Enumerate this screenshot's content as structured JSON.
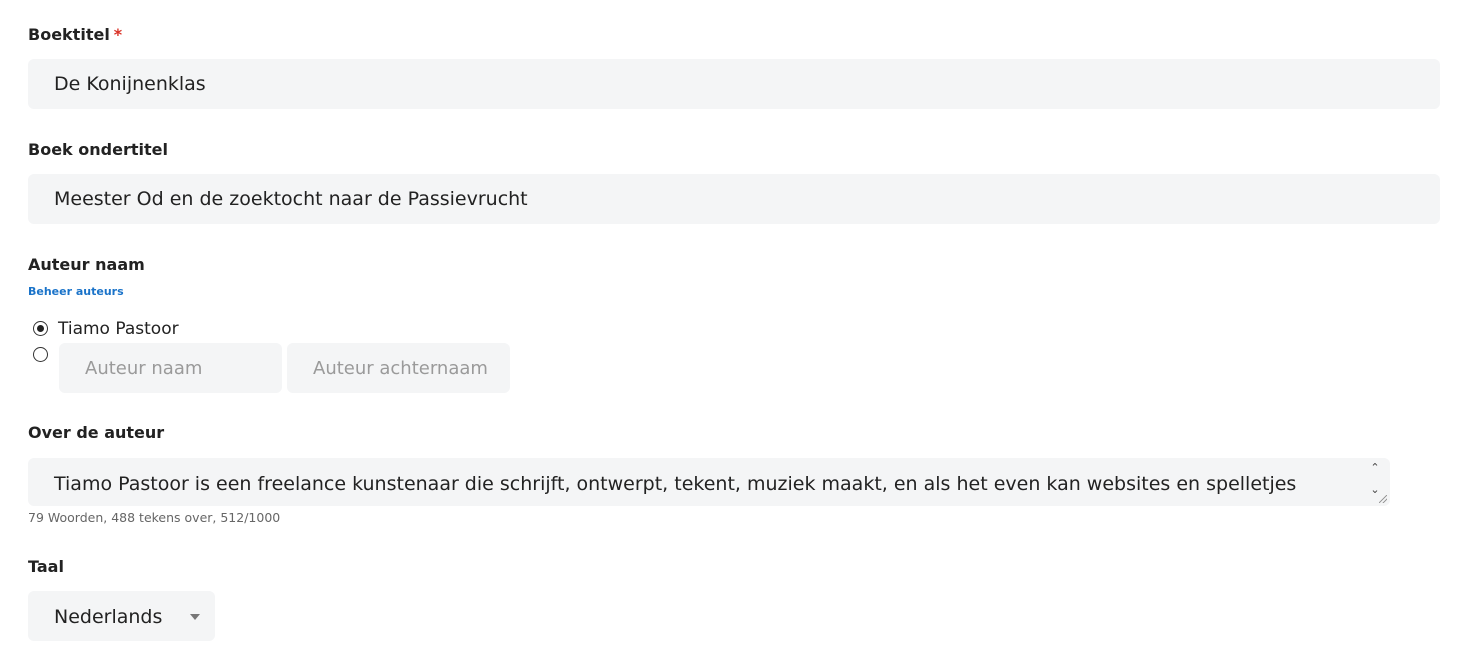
{
  "book_title": {
    "label": "Boektitel",
    "required_marker": "*",
    "value": "De Konijnenklas"
  },
  "book_subtitle": {
    "label": "Boek ondertitel",
    "value": "Meester Od en de zoektocht naar de Passievrucht"
  },
  "author": {
    "label": "Auteur naam",
    "manage_link": "Beheer auteurs",
    "options": [
      {
        "label": "Tiamo Pastoor",
        "selected": true
      },
      {
        "label": "",
        "selected": false
      }
    ],
    "first_name_placeholder": "Auteur naam",
    "last_name_placeholder": "Auteur achternaam"
  },
  "about_author": {
    "label": "Over de auteur",
    "value": "Tiamo Pastoor is een freelance kunstenaar die schrijft, ontwerpt, tekent, muziek maakt, en als het even kan websites en spelletjes",
    "counter": "79 Woorden, 488 tekens over, 512/1000",
    "icons": {
      "scroll_up": "chevron-up-icon",
      "scroll_down": "chevron-down-icon",
      "resize": "resize-grip-icon"
    }
  },
  "language": {
    "label": "Taal",
    "selected": "Nederlands",
    "icon": "caret-down-icon"
  },
  "colors": {
    "field_bg": "#f4f5f6",
    "text": "#222222",
    "link": "#1a73c9",
    "required": "#d93025",
    "placeholder": "#9a9a9a"
  }
}
